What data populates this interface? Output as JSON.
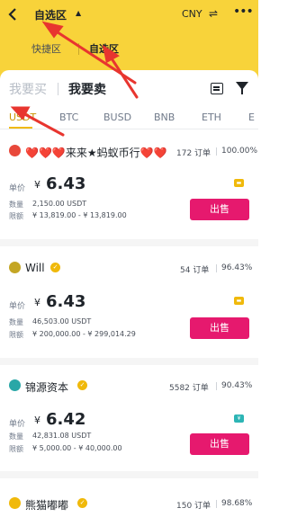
{
  "header": {
    "title": "自选区",
    "currency": "CNY",
    "swap_icon": "⇌",
    "more_icon": "•••"
  },
  "subtabs": [
    "快捷区",
    "自选区"
  ],
  "trade_tabs": {
    "buy": "我要买",
    "sell": "我要卖"
  },
  "assets": [
    "USDT",
    "BTC",
    "BUSD",
    "BNB",
    "ETH",
    "E"
  ],
  "labels": {
    "unit_price": "单价",
    "quantity": "数量",
    "limit": "限额",
    "currency_symbol": "¥",
    "sell_button": "出售"
  },
  "offers": [
    {
      "name": "❤️❤️❤️来来★蚂蚁币行❤️❤️",
      "orders": "172 订单",
      "rate": "100.00%",
      "price": "6.43",
      "quantity": "2,150.00 USDT",
      "limit": "¥ 13,819.00 - ¥ 13,819.00",
      "pay_icon": "bank-card-icon",
      "avatar_color": "#e8483a"
    },
    {
      "name": "Will",
      "orders": "54 订单",
      "rate": "96.43%",
      "price": "6.43",
      "quantity": "46,503.00 USDT",
      "limit": "¥ 200,000.00 - ¥ 299,014.29",
      "pay_icon": "bank-card-icon",
      "avatar_color": "#c4a624"
    },
    {
      "name": "锦源资本",
      "orders": "5582 订单",
      "rate": "90.43%",
      "price": "6.42",
      "quantity": "42,831.08 USDT",
      "limit": "¥ 5,000.00 - ¥ 40,000.00",
      "pay_icon": "wechat-pay-icon",
      "avatar_color": "#2aa7a7"
    },
    {
      "name": "熊猫嘟嘟",
      "orders": "150 订单",
      "rate": "98.68%",
      "avatar_color": "#f0b90b"
    }
  ],
  "colors": {
    "header_yellow": "#f8d33a",
    "accent": "#f0b90b",
    "sell_pink": "#e6196e",
    "annotation_red": "#e8352f"
  }
}
